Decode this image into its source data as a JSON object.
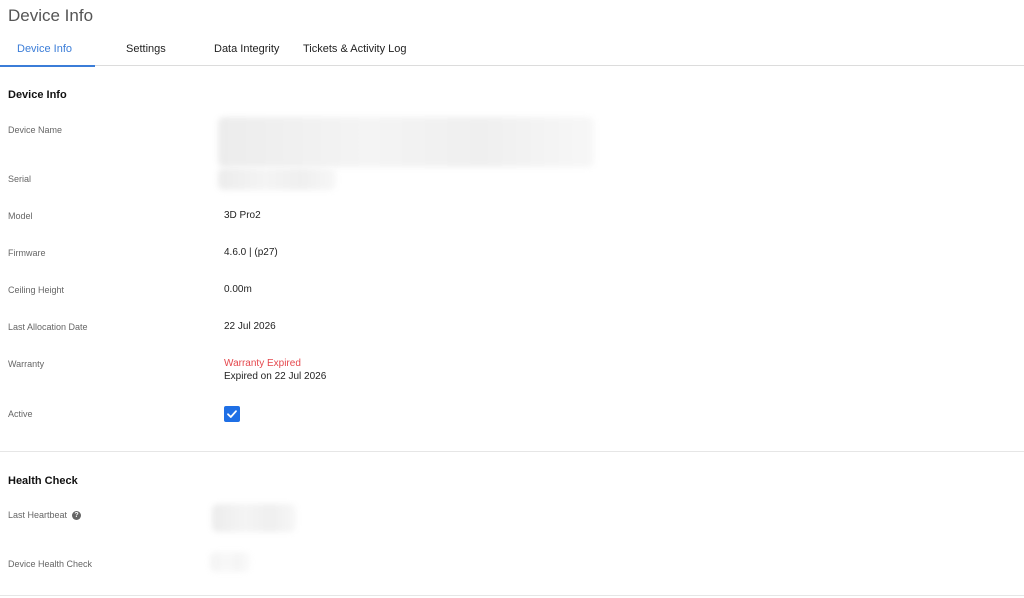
{
  "page": {
    "title": "Device Info"
  },
  "tabs": [
    {
      "label": "Device Info",
      "active": true
    },
    {
      "label": "Settings"
    },
    {
      "label": "Data Integrity"
    },
    {
      "label": "Tickets & Activity Log"
    }
  ],
  "device_info": {
    "section_title": "Device Info",
    "rows": [
      {
        "label": "Device Name",
        "value": ""
      },
      {
        "label": "Serial",
        "value": ""
      },
      {
        "label": "Model",
        "value": "3D Pro2"
      },
      {
        "label": "Firmware",
        "value": "4.6.0 | (p27)"
      },
      {
        "label": "Ceiling Height",
        "value": "0.00m"
      },
      {
        "label": "Last Allocation Date",
        "value": "22 Jul 2026"
      },
      {
        "label": "Warranty",
        "status": "Warranty Expired",
        "value": "Expired on 22 Jul 2026"
      },
      {
        "label": "Active",
        "checked": true
      }
    ]
  },
  "health_check": {
    "section_title": "Health Check",
    "rows": [
      {
        "label": "Last Heartbeat",
        "value": ""
      },
      {
        "label": "Device Health Check",
        "value": ""
      }
    ]
  },
  "colors": {
    "accent": "#3b7dd8",
    "checkbox": "#1f6fe5",
    "warning": "#e5484d"
  }
}
